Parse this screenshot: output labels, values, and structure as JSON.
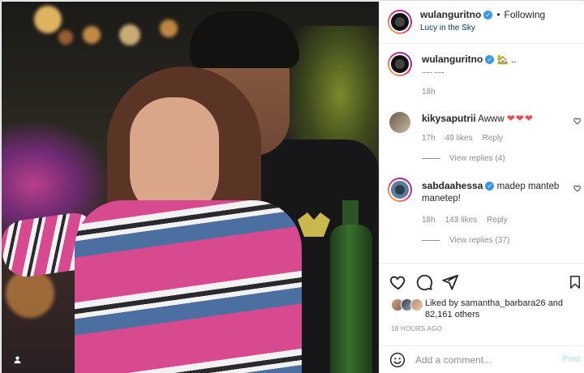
{
  "header": {
    "username": "wulanguritno",
    "dot": "•",
    "follow_status": "Following",
    "location": "Lucy in the Sky"
  },
  "caption": {
    "username": "wulanguritno",
    "emoji": "🏡",
    "text_suffix": "..",
    "second_line": "..... .....",
    "time": "18h"
  },
  "comments": [
    {
      "username": "kikysaputrii",
      "text": "Awww",
      "hearts": "❤❤❤",
      "time": "17h",
      "likes": "49 likes",
      "reply": "Reply",
      "view_replies": "View replies (4)"
    },
    {
      "username": "sabdaahessa",
      "text": "madep manteb manetep!",
      "time": "18h",
      "likes": "143 likes",
      "reply": "Reply",
      "view_replies": "View replies (37)"
    }
  ],
  "likes": {
    "prefix": "Liked by",
    "user": "samantha_barbara26",
    "middle": "and",
    "count": "82,161 others"
  },
  "timestamp": "18 HOURS AGO",
  "add_comment": {
    "placeholder": "Add a comment...",
    "post_label": "Post"
  },
  "colors": {
    "verified": "#3897f0",
    "link": "#00376b",
    "muted": "#8e8e8e",
    "post_disabled": "#b2dffc",
    "heart": "#ed4956"
  }
}
